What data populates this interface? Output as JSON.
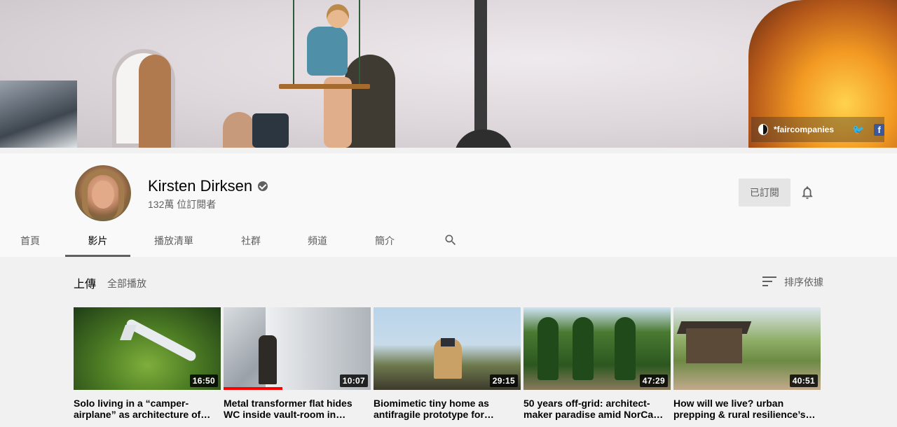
{
  "banner": {
    "brand_label": "*faircompanies",
    "social_icons": [
      "yin-yang-icon",
      "twitter-icon",
      "facebook-icon"
    ]
  },
  "channel": {
    "name": "Kirsten Dirksen",
    "subscribers": "132萬 位訂閱者",
    "subscribe_button": "已訂閱"
  },
  "tabs": [
    {
      "label": "首頁",
      "active": false
    },
    {
      "label": "影片",
      "active": true
    },
    {
      "label": "播放清單",
      "active": false
    },
    {
      "label": "社群",
      "active": false
    },
    {
      "label": "頻道",
      "active": false
    },
    {
      "label": "簡介",
      "active": false
    }
  ],
  "section": {
    "title": "上傳",
    "play_all": "全部播放",
    "sort_label": "排序依據"
  },
  "videos": [
    {
      "title": "Solo living in a “camper-airplane” as architecture of…",
      "duration": "16:50",
      "progress": 0
    },
    {
      "title": "Metal transformer flat hides WC inside vault-room in…",
      "duration": "10:07",
      "progress": 0.4
    },
    {
      "title": "Biomimetic tiny home as antifragile prototype for…",
      "duration": "29:15",
      "progress": 0
    },
    {
      "title": "50 years off-grid: architect-maker paradise amid NorCa…",
      "duration": "47:29",
      "progress": 0
    },
    {
      "title": "How will we live? urban prepping & rural resilience’s…",
      "duration": "40:51",
      "progress": 0
    }
  ],
  "colors": {
    "progress": "#ff0000",
    "header_bg": "#f9f9f9",
    "page_bg": "#f1f1f1",
    "subscribed_bg": "#e5e5e5"
  }
}
